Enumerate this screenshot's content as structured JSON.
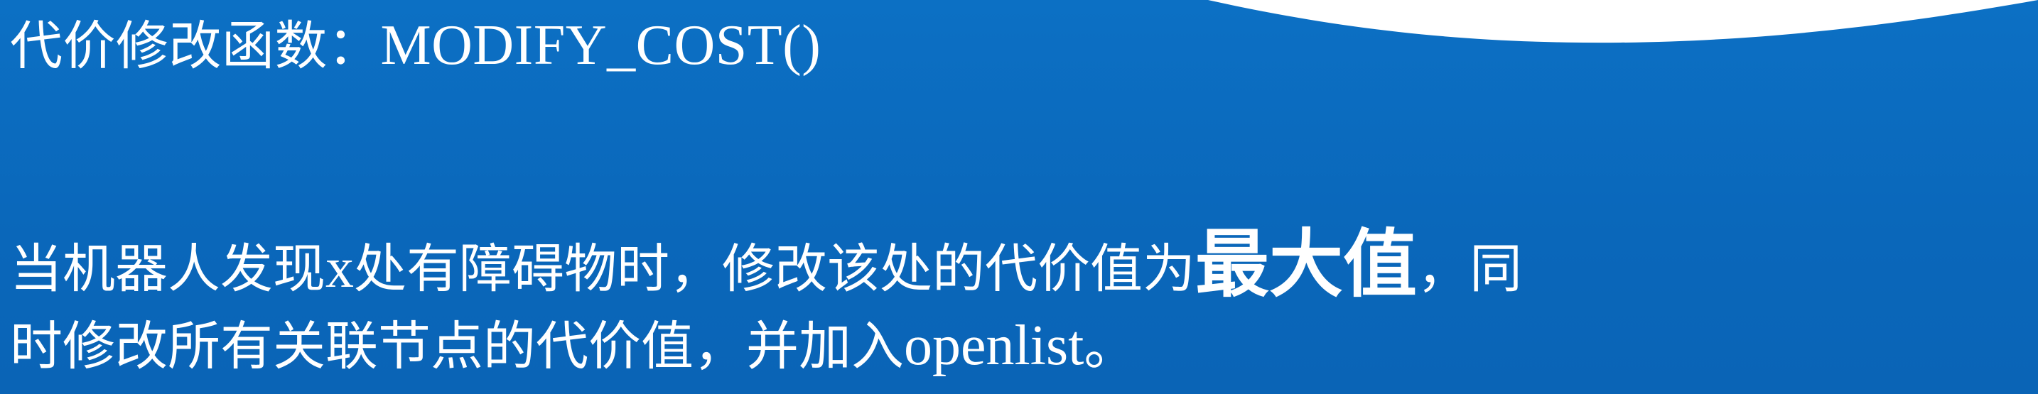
{
  "title": {
    "prefix": "代价修改函数：",
    "function_name": "MODIFY_COST()"
  },
  "body": {
    "line1_a": "当机器人发现",
    "line1_x": "x",
    "line1_b": "处有障碍物时，修改该处的代价值为",
    "line1_emph": "最大值",
    "line1_c": "，同",
    "line2_a": "时修改所有关联节点的代价值，并加入",
    "line2_openlist": "openlist",
    "line2_end": "。"
  },
  "colors": {
    "background": "#0b6cbf",
    "text": "#ffffff",
    "wave": "#ffffff"
  }
}
